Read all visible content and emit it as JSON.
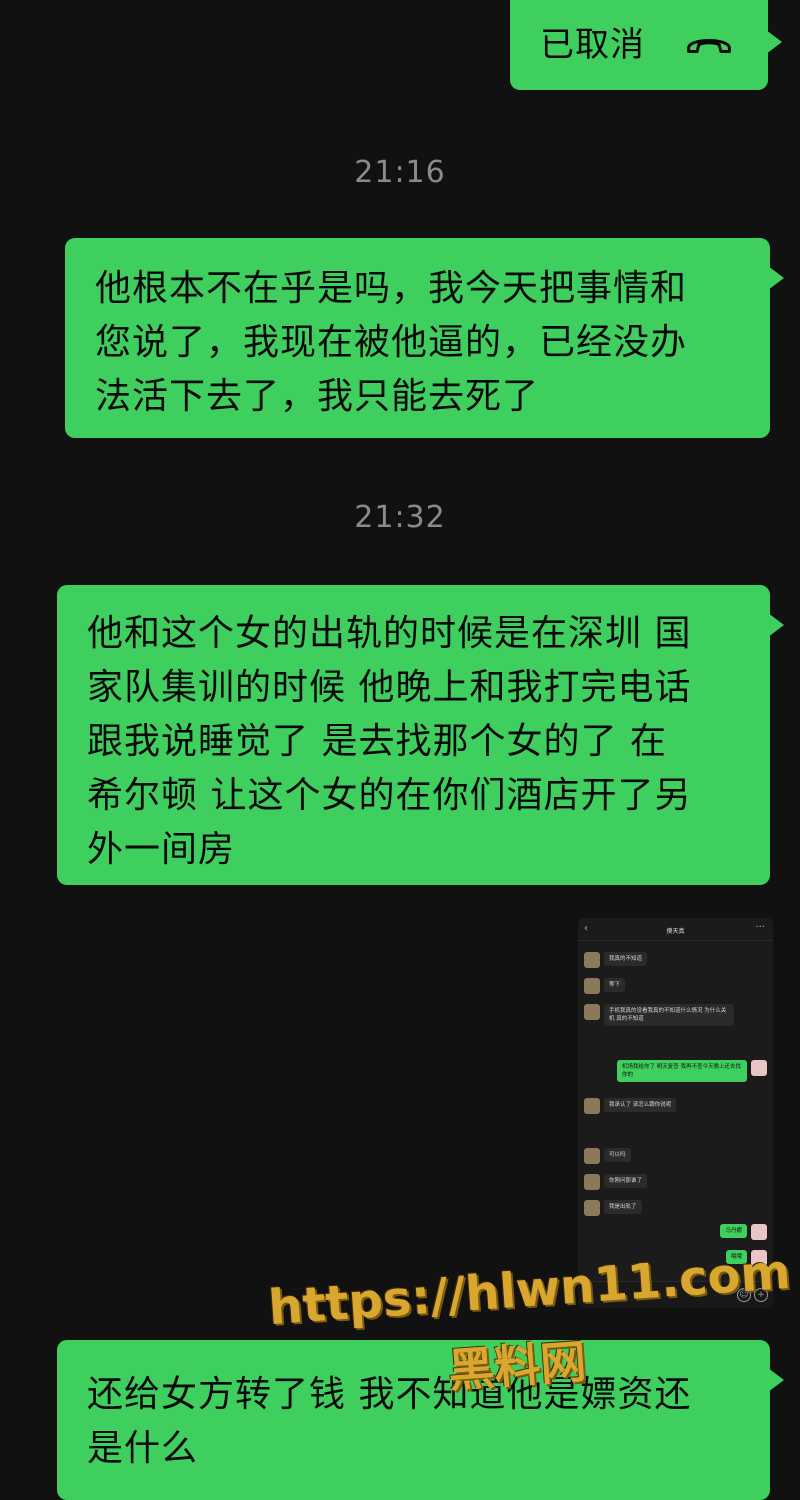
{
  "messages": [
    {
      "text": "已取消"
    },
    {
      "text": "他根本不在乎是吗，我今天把事情和\n您说了，我现在被他逼的，已经没办\n法活下去了，我只能去死了"
    },
    {
      "text": "他和这个女的出轨的时候是在深圳 国\n家队集训的时候 他晚上和我打完电话\n跟我说睡觉了 是去找那个女的了 在\n希尔顿 让这个女的在你们酒店开了另\n外一间房"
    },
    {
      "text": "还给女方转了钱 我不知道他是嫖资还\n是什么"
    }
  ],
  "timestamps": [
    "21:16",
    "21:32"
  ],
  "call_icon": "hang-up-phone-icon",
  "embedded_chat": {
    "title": "傻天真",
    "rows": [
      {
        "text": "我真的不知道"
      },
      {
        "text": "等下"
      },
      {
        "text": "手机我真的没看我真的不知道什么情况 为什么关机 真的不知道"
      },
      {
        "text": "机场我给你了 明天复查 我再不查今天晚上还去找你的"
      },
      {
        "text": "我承认了 该怎么跟你说呢"
      },
      {
        "text": "可以吗"
      },
      {
        "text": "你刚问那谁了"
      },
      {
        "text": "我是出轨了"
      },
      {
        "text": "马丹娜"
      },
      {
        "text": "哦哦"
      }
    ]
  },
  "watermark": {
    "url": "https://hlwn11.com",
    "name": "黑料网"
  },
  "colors": {
    "bubble": "#3fcf5f",
    "background": "#111111",
    "timestamp": "#8a8a8a"
  }
}
